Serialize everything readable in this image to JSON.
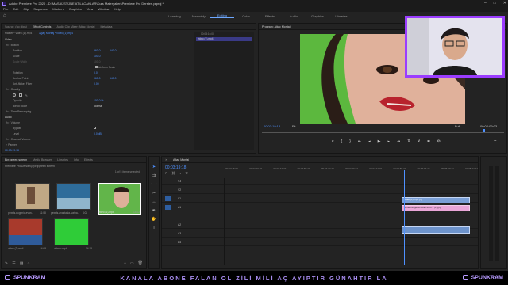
{
  "window": {
    "title": "Adobe Premiere Pro 2020 - D:\\MASAÜSTÜNE ATILACAKLAR\\Kurs Materyalleri\\Premiere Pro Dersleri.prproj *",
    "minimize": "–",
    "maximize": "□",
    "close": "✕"
  },
  "menu": [
    "File",
    "Edit",
    "Clip",
    "Sequence",
    "Markers",
    "Graphics",
    "View",
    "Window",
    "Help"
  ],
  "workspaces": {
    "items": [
      "Learning",
      "Assembly",
      "Editing",
      "Color",
      "Effects",
      "Audio",
      "Graphics",
      "Libraries"
    ],
    "active": "Editing"
  },
  "effects_panel": {
    "tabs": [
      "Source: (no clips)",
      "Effect Controls",
      "Audio Clip Mixer: Ağaç Montaj",
      "Metadata"
    ],
    "active_tab": "Effect Controls",
    "master": "Master * video (1).mp4",
    "sequence": "Ağaç Montaj * video (1).mp4",
    "clip_label": "video (1).mp4",
    "timecode_start": "00:03:16:00",
    "sections": {
      "video": "Video",
      "motion": "Motion",
      "position_label": "Position",
      "position_x": "960.0",
      "position_y": "540.0",
      "scale_label": "Scale",
      "scale_value": "100.0",
      "scale_width_label": "Scale Width",
      "scale_width_value": "100.0",
      "uniform_scale": "Uniform Scale",
      "rotation_label": "Rotation",
      "rotation_value": "0.0",
      "anchor_label": "Anchor Point",
      "anchor_x": "960.0",
      "anchor_y": "540.0",
      "flicker_label": "Anti-flicker Filter",
      "flicker_value": "0.00",
      "opacity_section": "Opacity",
      "opacity_label": "Opacity",
      "opacity_value": "100.0 %",
      "blend_label": "Blend Mode",
      "blend_value": "Normal",
      "time_remap": "Time Remapping",
      "audio": "Audio",
      "volume": "Volume",
      "bypass_label": "Bypass",
      "level_label": "Level",
      "level_value": "0.0 dB",
      "channel_volume": "Channel Volume",
      "panner": "Panner"
    },
    "timecode": "00:03:19:18"
  },
  "program_monitor": {
    "title": "Program: Ağaç Montaj",
    "timecode": "00:03:19:18",
    "fit": "Fit",
    "quality": "Full",
    "duration": "00:04:09:03"
  },
  "project_panel": {
    "tabs": [
      "Bin: green screen",
      "Media Browser",
      "Libraries",
      "Info",
      "Effects"
    ],
    "active_tab": "Bin: green screen",
    "path": "Premiere Pro Dersleri.prproj\\green screen",
    "selection": "1 of 5 items selected",
    "items": [
      {
        "name": "pexels-eugenio-evan...",
        "duration": "11:08"
      },
      {
        "name": "pexels-anastasia-sorina...",
        "duration": "4:02"
      },
      {
        "name": "video (1).mp4",
        "duration": "14:02"
      },
      {
        "name": "video (2).mp4",
        "duration": "14:09"
      },
      {
        "name": "videoo.mp4",
        "duration": "14:15"
      }
    ]
  },
  "timeline": {
    "tab": "Ağaç Montaj",
    "timecode": "00:03:19:18",
    "ruler": [
      "00:03:15:00",
      "00:03:29:23",
      "00:03:44:23",
      "00:03:59:23",
      "00:04:14:23",
      "00:04:29:23",
      "00:04:44:23",
      "00:04:59:22",
      "00:05:14:22",
      "00:05:29:22",
      "00:05:44:22"
    ],
    "tracks": [
      "V3",
      "V2",
      "V1",
      "A1",
      "A2",
      "A3",
      "A4"
    ],
    "clips": [
      {
        "label": "video (1).mp4 [V]"
      },
      {
        "label": "pexels-eugenio-evan-10071 (1).jpg"
      },
      {
        "label": ""
      }
    ]
  },
  "ticker": {
    "brand_left": "SPUNKRAM",
    "message": "KANALA ABONE FALAN OL ZİLİ MİLİ AÇ AYIPTIR GÜNAHTIR LA",
    "brand_right": "SPUNKRAM"
  },
  "colors": {
    "accent": "#4f91ff",
    "clip_blue": "#7a9fd6",
    "clip_pink": "#e9a6d8",
    "ticker_purple": "#a88cf0",
    "webcam_border": "#9b3dff"
  }
}
